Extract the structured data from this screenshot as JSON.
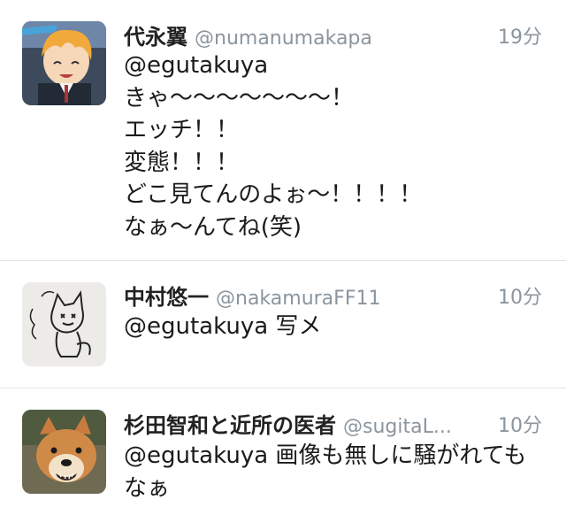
{
  "tweets": [
    {
      "name": "代永翼",
      "handle": "@numanumakapa",
      "time": "19分",
      "avatar": "anime-character-avatar",
      "text_lines": [
        "@egutakuya",
        "きゃ〜〜〜〜〜〜〜！",
        "エッチ！！",
        "変態！！！",
        "どこ見てんのよぉ〜！！！！",
        "なぁ〜んてね(笑)"
      ]
    },
    {
      "name": "中村悠一",
      "handle": "@nakamuraFF11",
      "time": "10分",
      "avatar": "cat-sketch-avatar",
      "text_lines": [
        "@egutakuya 写メ"
      ]
    },
    {
      "name": "杉田智和と近所の医者",
      "handle": "@sugitaL...",
      "time": "10分",
      "avatar": "shiba-dog-avatar",
      "text_lines": [
        "@egutakuya 画像も無しに騒がれても",
        "なぁ"
      ]
    }
  ]
}
